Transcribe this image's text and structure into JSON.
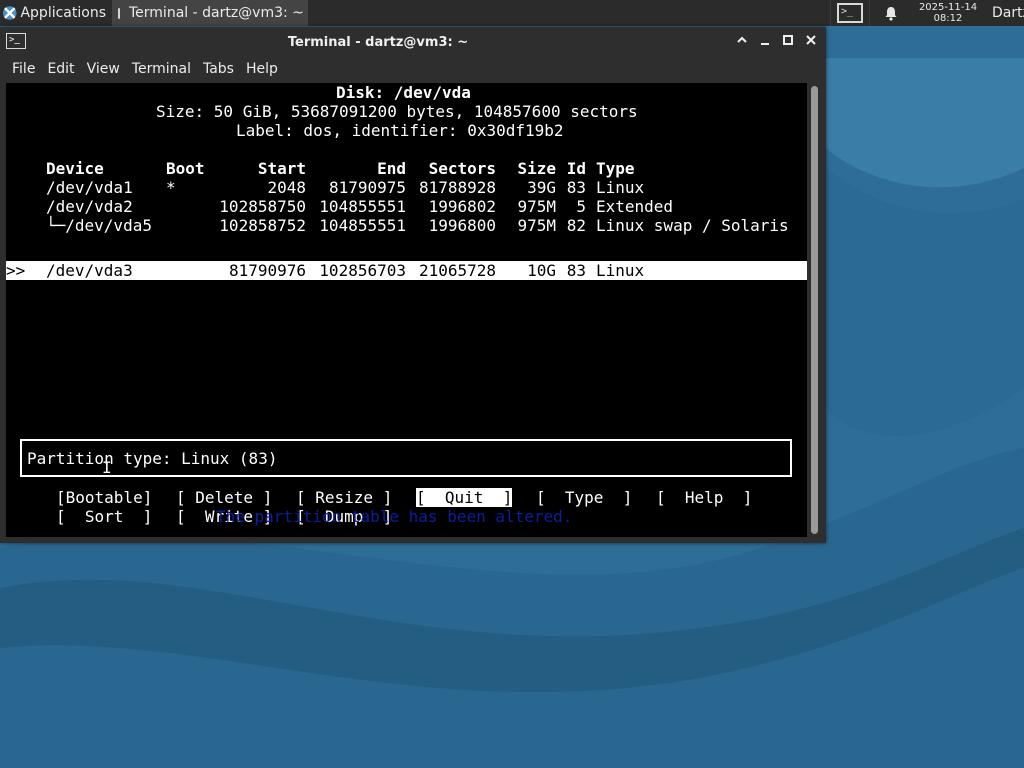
{
  "panel": {
    "applications_label": "Applications",
    "task_title": "Terminal - dartz@vm3: ~",
    "clock_date": "2025-11-14",
    "clock_time": "08:12",
    "user": "Dartz"
  },
  "window": {
    "title": "Terminal - dartz@vm3: ~",
    "menu": [
      "File",
      "Edit",
      "View",
      "Terminal",
      "Tabs",
      "Help"
    ]
  },
  "cfdisk": {
    "disk_line": "Disk: /dev/vda",
    "size_line": "Size: 50 GiB, 53687091200 bytes, 104857600 sectors",
    "label_line": "Label: dos, identifier: 0x30df19b2",
    "headers": [
      "Device",
      "Boot",
      "Start",
      "End",
      "Sectors",
      "Size",
      "Id",
      "Type"
    ],
    "rows": [
      {
        "device": "/dev/vda1",
        "boot": "*",
        "start": "2048",
        "end": "81790975",
        "sectors": "81788928",
        "size": "39G",
        "id": "83",
        "type": "Linux"
      },
      {
        "device": "/dev/vda2",
        "boot": "",
        "start": "102858750",
        "end": "104855551",
        "sectors": "1996802",
        "size": "975M",
        "id": "5",
        "type": "Extended"
      },
      {
        "device": "└─/dev/vda5",
        "boot": "",
        "start": "102858752",
        "end": "104855551",
        "sectors": "1996800",
        "size": "975M",
        "id": "82",
        "type": "Linux swap / Solaris"
      },
      {
        "device": "/dev/vda3",
        "boot": "",
        "start": "81790976",
        "end": "102856703",
        "sectors": "21065728",
        "size": "10G",
        "id": "83",
        "type": "Linux"
      }
    ],
    "selected_marker": ">>",
    "info": "Partition type: Linux (83)",
    "buttons_row1": [
      "[Bootable]",
      "[ Delete ]",
      "[ Resize ]",
      "[  Quit  ]",
      "[  Type  ]",
      "[  Help  ]"
    ],
    "buttons_row2": [
      "[  Sort  ]",
      "[  Write ]",
      "[  Dump  ]"
    ],
    "active_button": "[  Quit  ]",
    "status": "The partition table has been altered."
  },
  "colors": {
    "panel_bg": "#2b2b2b",
    "window_bg": "#2e2e2e",
    "terminal_bg": "#000000",
    "status_text": "#0b1f9e",
    "desktop": "#2f6e96"
  }
}
